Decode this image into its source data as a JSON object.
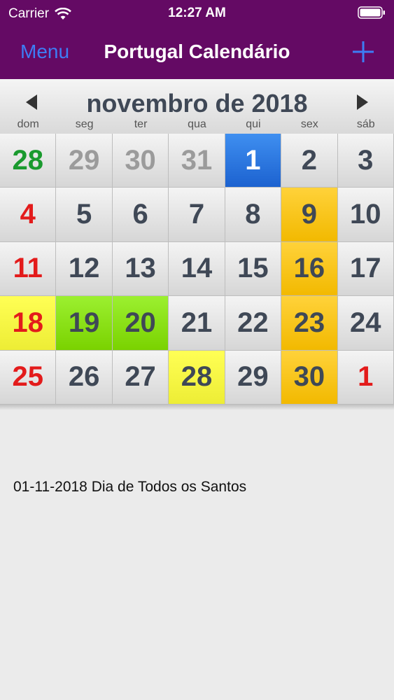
{
  "status_bar": {
    "carrier": "Carrier",
    "time": "12:27 AM"
  },
  "nav": {
    "menu_label": "Menu",
    "title": "Portugal Calendário",
    "add_icon": "plus-icon"
  },
  "calendar": {
    "month_title": "novembro de 2018",
    "prev_icon": "triangle-left-icon",
    "next_icon": "triangle-right-icon",
    "weekdays": [
      "dom",
      "seg",
      "ter",
      "qua",
      "qui",
      "sex",
      "sáb"
    ],
    "days": [
      {
        "day": "28",
        "style": "green",
        "bg": ""
      },
      {
        "day": "29",
        "style": "gray",
        "bg": ""
      },
      {
        "day": "30",
        "style": "gray",
        "bg": ""
      },
      {
        "day": "31",
        "style": "gray",
        "bg": ""
      },
      {
        "day": "1",
        "style": "white",
        "bg": "blue"
      },
      {
        "day": "2",
        "style": "",
        "bg": ""
      },
      {
        "day": "3",
        "style": "",
        "bg": ""
      },
      {
        "day": "4",
        "style": "red",
        "bg": ""
      },
      {
        "day": "5",
        "style": "",
        "bg": ""
      },
      {
        "day": "6",
        "style": "",
        "bg": ""
      },
      {
        "day": "7",
        "style": "",
        "bg": ""
      },
      {
        "day": "8",
        "style": "",
        "bg": ""
      },
      {
        "day": "9",
        "style": "",
        "bg": "orange"
      },
      {
        "day": "10",
        "style": "",
        "bg": ""
      },
      {
        "day": "11",
        "style": "red",
        "bg": ""
      },
      {
        "day": "12",
        "style": "",
        "bg": ""
      },
      {
        "day": "13",
        "style": "",
        "bg": ""
      },
      {
        "day": "14",
        "style": "",
        "bg": ""
      },
      {
        "day": "15",
        "style": "",
        "bg": ""
      },
      {
        "day": "16",
        "style": "",
        "bg": "orange"
      },
      {
        "day": "17",
        "style": "",
        "bg": ""
      },
      {
        "day": "18",
        "style": "red",
        "bg": "yellow"
      },
      {
        "day": "19",
        "style": "",
        "bg": "green"
      },
      {
        "day": "20",
        "style": "",
        "bg": "green"
      },
      {
        "day": "21",
        "style": "",
        "bg": ""
      },
      {
        "day": "22",
        "style": "",
        "bg": ""
      },
      {
        "day": "23",
        "style": "",
        "bg": "orange"
      },
      {
        "day": "24",
        "style": "",
        "bg": ""
      },
      {
        "day": "25",
        "style": "red",
        "bg": ""
      },
      {
        "day": "26",
        "style": "",
        "bg": ""
      },
      {
        "day": "27",
        "style": "",
        "bg": ""
      },
      {
        "day": "28",
        "style": "",
        "bg": "yellow"
      },
      {
        "day": "29",
        "style": "",
        "bg": ""
      },
      {
        "day": "30",
        "style": "",
        "bg": "orange"
      },
      {
        "day": "1",
        "style": "red",
        "bg": ""
      }
    ]
  },
  "holidays": [
    "01-11-2018 Dia de Todos os Santos"
  ],
  "colors": {
    "nav_background": "#640a64",
    "menu_blue": "#3d7df5",
    "selected_blue": "#2a78e4",
    "highlight_orange": "#f5c400",
    "highlight_yellow": "#f7f744",
    "highlight_green": "#8ae01a",
    "sunday_red": "#e31b1b"
  }
}
